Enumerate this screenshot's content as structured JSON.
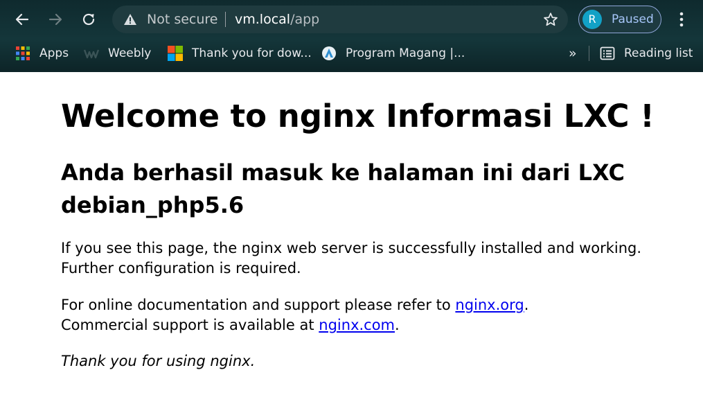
{
  "browser": {
    "nav": {
      "back_icon": "arrow-left-icon",
      "forward_icon": "arrow-right-icon",
      "reload_icon": "reload-icon"
    },
    "omnibox": {
      "security_label": "Not secure",
      "url_host": "vm.local",
      "url_path": "/app",
      "warning_icon": "warning-triangle-icon",
      "bookmark_icon": "star-icon"
    },
    "profile": {
      "initial": "R",
      "status": "Paused"
    },
    "menu_icon": "kebab-menu-icon",
    "bookmarks": [
      {
        "label": "Apps",
        "icon": "apps-grid-icon"
      },
      {
        "label": "Weebly",
        "icon": "weebly-logo-icon"
      },
      {
        "label": "Thank you for dow...",
        "icon": "microsoft-logo-icon"
      },
      {
        "label": "Program Magang |...",
        "icon": "site-favicon-icon"
      }
    ],
    "overflow_label": "»",
    "reading_list_label": "Reading list",
    "colors": {
      "frame": "#0f2a2e",
      "omnibox": "#1f3b3f",
      "profile_accent": "#8fa6d9",
      "avatar": "#12a1c6",
      "link": "#0000ee"
    }
  },
  "page": {
    "title": "Welcome to nginx Informasi LXC !",
    "subtitle": "Anda berhasil masuk ke halaman ini dari LXC debian_php5.6",
    "intro": "If you see this page, the nginx web server is successfully installed and working. Further configuration is required.",
    "docs_prefix": "For online documentation and support please refer to ",
    "docs_link": "nginx.org",
    "docs_suffix": ".",
    "commercial_prefix": "Commercial support is available at ",
    "commercial_link": "nginx.com",
    "commercial_suffix": ".",
    "thanks": "Thank you for using nginx."
  }
}
